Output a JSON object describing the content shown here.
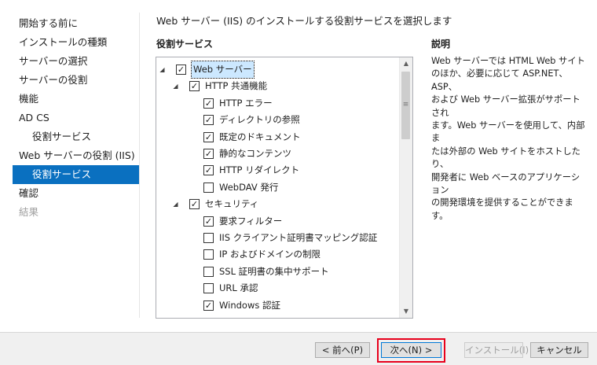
{
  "nav": {
    "items": [
      {
        "label": "開始する前に",
        "state": "normal",
        "sub": false
      },
      {
        "label": "インストールの種類",
        "state": "normal",
        "sub": false
      },
      {
        "label": "サーバーの選択",
        "state": "normal",
        "sub": false
      },
      {
        "label": "サーバーの役割",
        "state": "normal",
        "sub": false
      },
      {
        "label": "機能",
        "state": "normal",
        "sub": false
      },
      {
        "label": "AD CS",
        "state": "normal",
        "sub": false
      },
      {
        "label": "役割サービス",
        "state": "normal",
        "sub": true
      },
      {
        "label": "Web サーバーの役割 (IIS)",
        "state": "normal",
        "sub": false
      },
      {
        "label": "役割サービス",
        "state": "active",
        "sub": true
      },
      {
        "label": "確認",
        "state": "normal",
        "sub": false
      },
      {
        "label": "結果",
        "state": "disabled",
        "sub": false
      }
    ]
  },
  "page_title": "Web サーバー (IIS) のインストールする役割サービスを選択します",
  "role_services_label": "役割サービス",
  "description_label": "説明",
  "tree": {
    "items": [
      {
        "label": "Web サーバー",
        "level": 0,
        "expander": true,
        "checked": true,
        "selected": true
      },
      {
        "label": "HTTP 共通機能",
        "level": 1,
        "expander": true,
        "checked": true
      },
      {
        "label": "HTTP エラー",
        "level": 2,
        "expander": false,
        "checked": true
      },
      {
        "label": "ディレクトリの参照",
        "level": 2,
        "expander": false,
        "checked": true
      },
      {
        "label": "既定のドキュメント",
        "level": 2,
        "expander": false,
        "checked": true
      },
      {
        "label": "静的なコンテンツ",
        "level": 2,
        "expander": false,
        "checked": true
      },
      {
        "label": "HTTP リダイレクト",
        "level": 2,
        "expander": false,
        "checked": true
      },
      {
        "label": "WebDAV 発行",
        "level": 2,
        "expander": false,
        "checked": false
      },
      {
        "label": "セキュリティ",
        "level": 1,
        "expander": true,
        "checked": true
      },
      {
        "label": "要求フィルター",
        "level": 2,
        "expander": false,
        "checked": true
      },
      {
        "label": "IIS クライアント証明書マッピング認証",
        "level": 2,
        "expander": false,
        "checked": false
      },
      {
        "label": "IP およびドメインの制限",
        "level": 2,
        "expander": false,
        "checked": false
      },
      {
        "label": "SSL 証明書の集中サポート",
        "level": 2,
        "expander": false,
        "checked": false
      },
      {
        "label": "URL 承認",
        "level": 2,
        "expander": false,
        "checked": false
      },
      {
        "label": "Windows 認証",
        "level": 2,
        "expander": false,
        "checked": true
      }
    ]
  },
  "description_lines": [
    "Web サーバーでは HTML Web サイト",
    "のほか、必要に応じて ASP.NET、ASP、",
    "および Web サーバー拡張がサポートされ",
    "ます。Web サーバーを使用して、内部ま",
    "たは外部の Web サイトをホストしたり、",
    "開発者に Web ベースのアプリケーション",
    "の開発環境を提供することができます。"
  ],
  "buttons": {
    "prev": "< 前へ(P)",
    "next": "次へ(N) >",
    "install": "インストール(I)",
    "cancel": "キャンセル"
  },
  "icons": {
    "expander": "expanded-triangle-icon",
    "check": "checkmark-icon",
    "scroll_up": "scroll-up-arrow-icon",
    "scroll_down": "scroll-down-arrow-icon"
  },
  "colors": {
    "accent": "#0a70c0",
    "highlight": "#e8001c"
  }
}
